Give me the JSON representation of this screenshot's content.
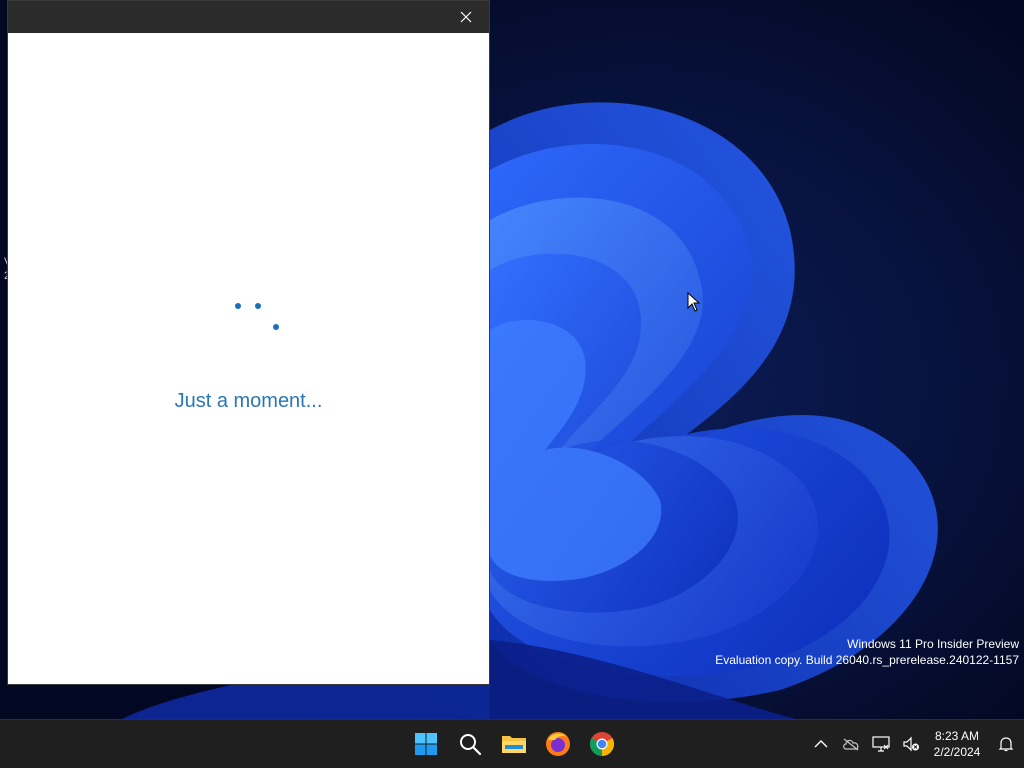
{
  "desktop": {
    "edge_text": [
      "V",
      "2"
    ],
    "watermark": {
      "line1": "Windows 11 Pro Insider Preview",
      "line2": "Evaluation copy. Build 26040.rs_prerelease.240122-1157"
    }
  },
  "dialog": {
    "title": "",
    "close_icon": "close-icon",
    "status_text": "Just a moment...",
    "spinner_icon": "loading-spinner-icon"
  },
  "taskbar": {
    "pinned": [
      {
        "name": "Start",
        "icon": "windows-start-icon"
      },
      {
        "name": "Search",
        "icon": "search-icon"
      },
      {
        "name": "File Explorer",
        "icon": "file-explorer-icon"
      },
      {
        "name": "Firefox",
        "icon": "firefox-icon"
      },
      {
        "name": "Chrome",
        "icon": "chrome-icon"
      }
    ],
    "tray": {
      "icons": [
        "chevron-up-icon",
        "network-offline-icon",
        "display-icon",
        "volume-muted-icon",
        "notification-bell-icon"
      ],
      "time": "8:23 AM",
      "date": "2/2/2024"
    }
  },
  "colors": {
    "accent": "#2a76b5",
    "taskbar": "#1f1f1f",
    "titlebar": "#2b2b2b",
    "spinner": "#1a6fb8"
  }
}
